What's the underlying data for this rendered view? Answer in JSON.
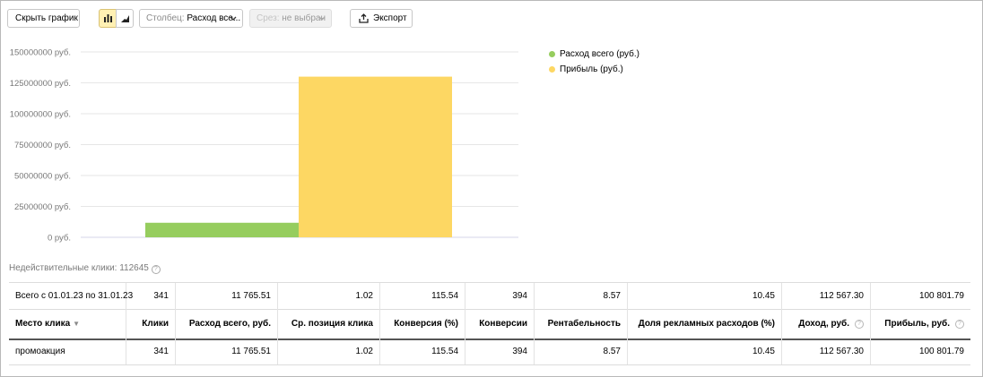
{
  "toolbar": {
    "hide_chart_label": "Скрыть график",
    "column_prefix": "Столбец:",
    "column_value": "Расход все...",
    "slice_prefix": "Срез:",
    "slice_value": "не выбран",
    "export_label": "Экспорт",
    "chart_type_icons": [
      "bar-chart-icon",
      "area-chart-icon"
    ]
  },
  "colors": {
    "green": "#96cd5e",
    "yellow": "#fdd763",
    "accent": "#fff0b3",
    "grid": "#e6e6e6",
    "axis": "#d6d6e8"
  },
  "chart_data": {
    "type": "bar",
    "series": [
      {
        "name": "Расход всего (руб.)",
        "value": 11765510,
        "color": "#96cd5e"
      },
      {
        "name": "Прибыль (руб.)",
        "value": 130000000,
        "color": "#fdd763"
      }
    ],
    "y_ticks": [
      "0 руб.",
      "25000000 руб.",
      "50000000 руб.",
      "75000000 руб.",
      "100000000 руб.",
      "125000000 руб.",
      "150000000 руб."
    ],
    "y_tick_values": [
      0,
      25000000,
      50000000,
      75000000,
      100000000,
      125000000,
      150000000
    ],
    "ylim": [
      0,
      150000000
    ],
    "grid": true,
    "legend_position": "right"
  },
  "invalid_clicks": {
    "label": "Недействительные клики: 112645"
  },
  "table": {
    "total": [
      "Всего с 01.01.23 по 31.01.23",
      "341",
      "11 765.51",
      "1.02",
      "115.54",
      "394",
      "8.57",
      "10.45",
      "112 567.30",
      "100 801.79"
    ],
    "headers": [
      "Место клика",
      "Клики",
      "Расход всего, руб.",
      "Ср. позиция клика",
      "Конверсия (%)",
      "Конверсии",
      "Рентабельность",
      "Доля рекламных расходов (%)",
      "Доход, руб.",
      "Прибыль, руб."
    ],
    "sort_arrow": "▼",
    "rows": [
      [
        "промоакция",
        "341",
        "11 765.51",
        "1.02",
        "115.54",
        "394",
        "8.57",
        "10.45",
        "112 567.30",
        "100 801.79"
      ]
    ]
  }
}
